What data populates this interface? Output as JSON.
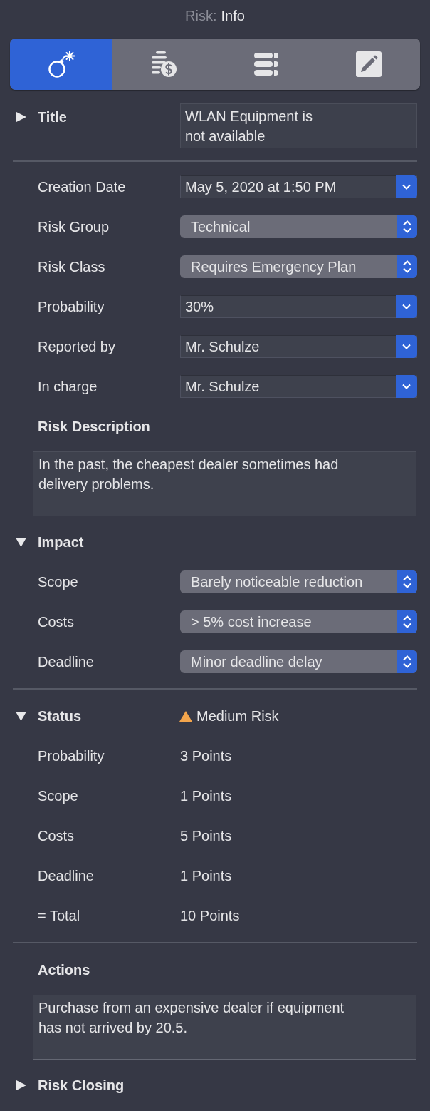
{
  "header": {
    "prefix": "Risk:",
    "title": "Info"
  },
  "tabs": [
    {
      "selected": true
    },
    {
      "selected": false
    },
    {
      "selected": false
    },
    {
      "selected": false
    }
  ],
  "title_section": {
    "label": "Title",
    "expanded": false,
    "value": "WLAN Equipment is\nnot available"
  },
  "fields": [
    {
      "label": "Creation Date",
      "kind": "combo",
      "value": "May 5, 2020 at 1:50 PM"
    },
    {
      "label": "Risk Group",
      "kind": "popup",
      "value": "Technical"
    },
    {
      "label": "Risk Class",
      "kind": "popup",
      "value": "Requires Emergency Plan"
    },
    {
      "label": "Probability",
      "kind": "combo",
      "value": "30%"
    },
    {
      "label": "Reported by",
      "kind": "combo",
      "value": "Mr. Schulze"
    },
    {
      "label": "In charge",
      "kind": "combo",
      "value": "Mr. Schulze"
    }
  ],
  "risk_description": {
    "label": "Risk Description",
    "value": "In the past, the cheapest dealer sometimes had delivery problems."
  },
  "impact": {
    "label": "Impact",
    "expanded": true,
    "fields": [
      {
        "label": "Scope",
        "kind": "popup",
        "value": "Barely noticeable reduction"
      },
      {
        "label": "Costs",
        "kind": "popup",
        "value": "> 5% cost increase"
      },
      {
        "label": "Deadline",
        "kind": "popup",
        "value": "Minor deadline delay"
      }
    ]
  },
  "status": {
    "label": "Status",
    "expanded": true,
    "value": "Medium Risk",
    "color": "#f3a54c",
    "rows": [
      {
        "label": "Probability",
        "value": "3 Points"
      },
      {
        "label": "Scope",
        "value": "1 Points"
      },
      {
        "label": "Costs",
        "value": "5 Points"
      },
      {
        "label": "Deadline",
        "value": "1 Points"
      },
      {
        "label": "= Total",
        "value": "10 Points"
      }
    ]
  },
  "actions": {
    "label": "Actions",
    "value": "Purchase from an expensive dealer if equipment has not arrived by 20.5."
  },
  "risk_closing": {
    "label": "Risk Closing",
    "expanded": false
  }
}
